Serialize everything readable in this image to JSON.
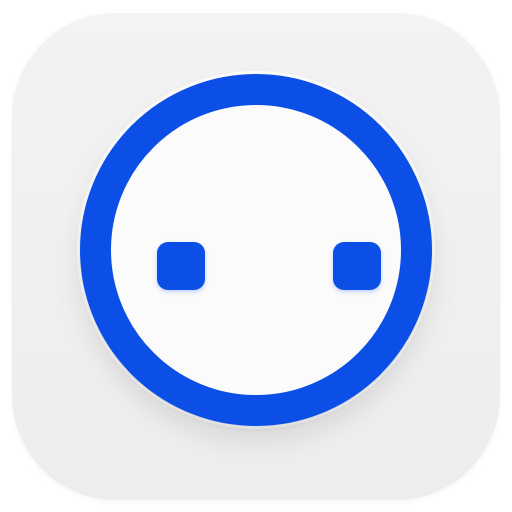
{
  "icon": {
    "name": "app-icon",
    "background_color": "#efefef",
    "ring_color": "#0b4fe6",
    "face_color": "#fbfbfc",
    "eye_color": "#0b4fe6"
  }
}
